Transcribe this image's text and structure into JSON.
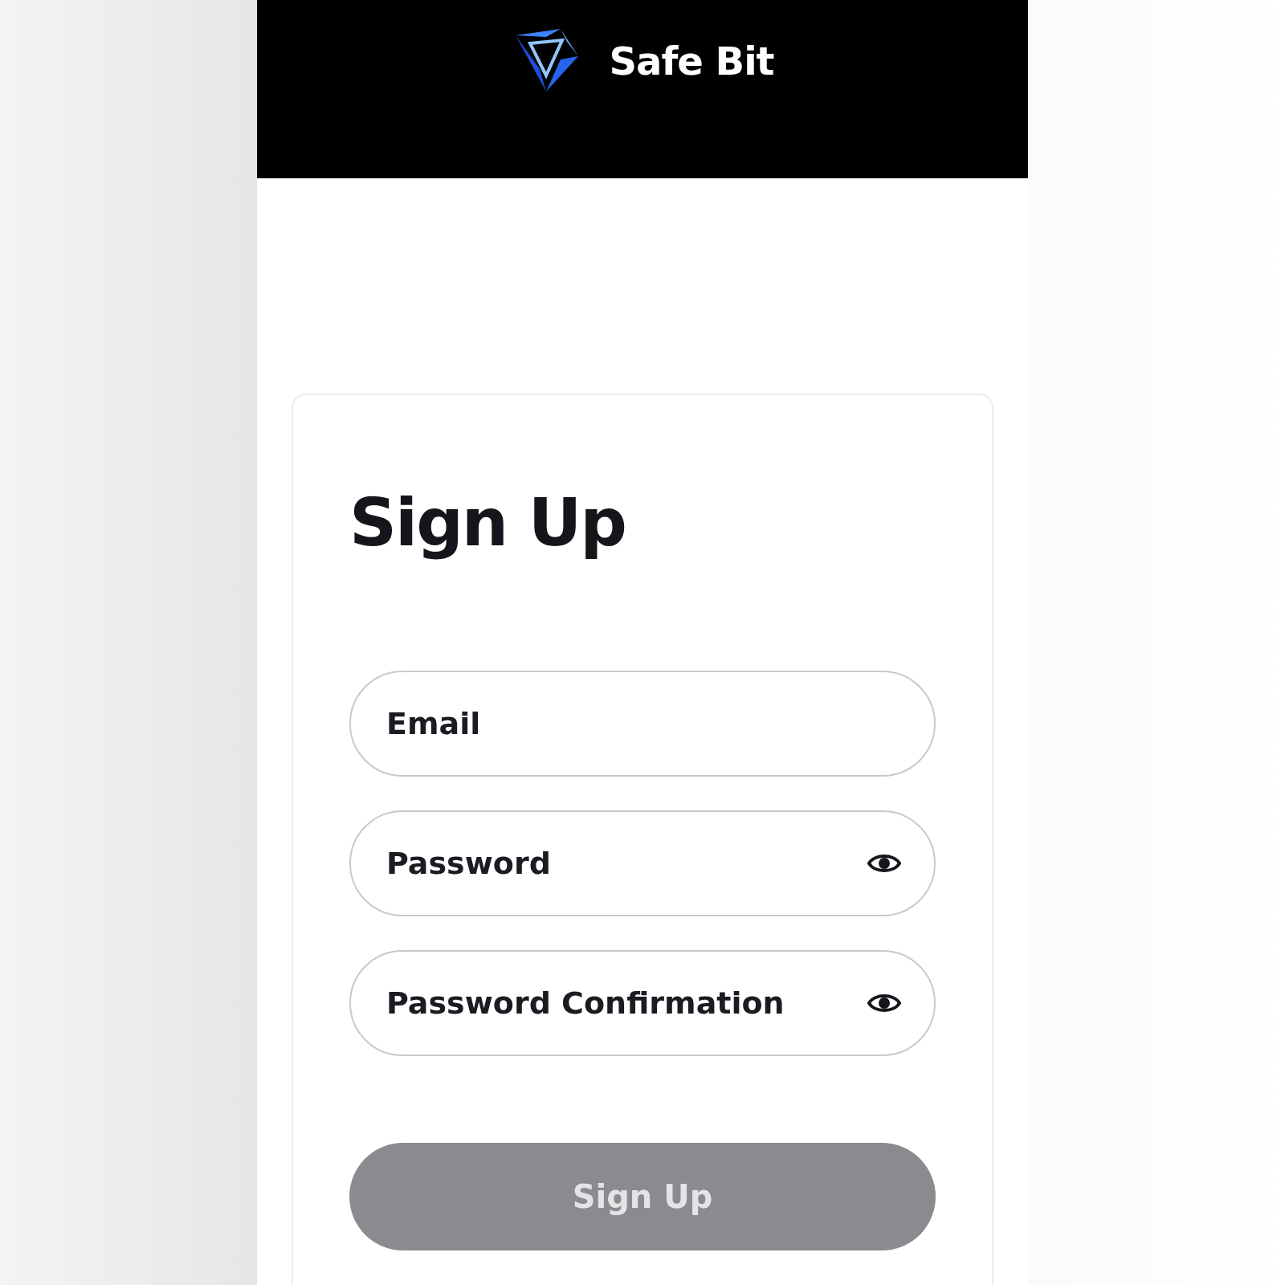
{
  "header": {
    "brand": "Safe Bit"
  },
  "form": {
    "title": "Sign Up",
    "fields": [
      {
        "placeholder": "Email",
        "kind": "text"
      },
      {
        "placeholder": "Password",
        "kind": "password"
      },
      {
        "placeholder": "Password Confirmation",
        "kind": "password"
      }
    ],
    "submit": {
      "label": "Sign Up",
      "disabled": true
    }
  }
}
